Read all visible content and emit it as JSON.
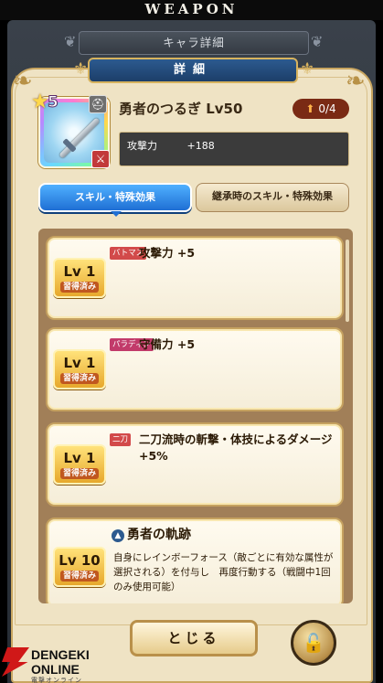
{
  "banner": {
    "text": "WEAPON"
  },
  "header": {
    "title": "キャラ詳細"
  },
  "panel": {
    "tab_title": "詳細"
  },
  "weapon": {
    "rarity": "5",
    "type_icon": "helmet-icon",
    "name": "勇者のつるぎ Lv50",
    "upgrade": "0/4",
    "stat_label": "攻撃力",
    "stat_value": "+188"
  },
  "tabs": {
    "active": "スキル・特殊効果",
    "inactive": "継承時のスキル・特殊効果"
  },
  "skills": [
    {
      "level": "Lv 1",
      "status": "習得済み",
      "tag": "バトマス",
      "effect": "攻撃力 +5"
    },
    {
      "level": "Lv 1",
      "status": "習得済み",
      "tag": "パラディン",
      "effect": "守備力 +5"
    },
    {
      "level": "Lv 1",
      "status": "習得済み",
      "tag": "二刀",
      "effect": "二刀流時の斬撃・体技によるダメージ +5%"
    },
    {
      "level": "Lv 10",
      "status": "習得済み",
      "title": "勇者の軌跡",
      "description": "自身にレインボーフォース（敵ごとに有効な属性が選択される）を付与し　再度行動する（戦闘中1回のみ使用可能）"
    }
  ],
  "footer": {
    "close_label": "とじる"
  },
  "watermark": {
    "line1": "DENGEKI",
    "line2": "ONLINE",
    "sub": "電撃オンライン"
  },
  "colors": {
    "accent_blue": "#1f6fd4",
    "gold": "#c6a260",
    "parchment": "#efe3c4"
  }
}
